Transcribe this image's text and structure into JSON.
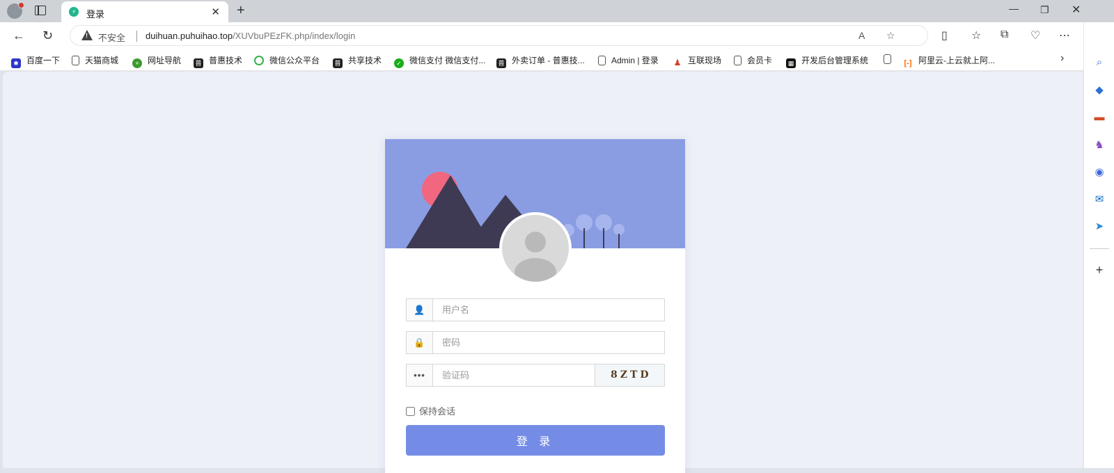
{
  "tab": {
    "title": "登录"
  },
  "address": {
    "insecure_label": "不安全",
    "host": "duihuan.puhuihao.top",
    "path": "/XUVbuPEzFK.php/index/login"
  },
  "bookmarks": [
    {
      "label": "百度一下",
      "icon": "paw-icon",
      "color": "#2b35c9"
    },
    {
      "label": "天猫商城",
      "icon": "page-icon",
      "color": "#555555"
    },
    {
      "label": "网址导航",
      "icon": "navigation-icon",
      "color": "#3c9a2e"
    },
    {
      "label": "普惠技术",
      "icon": "puhui-icon",
      "color": "#222222"
    },
    {
      "label": "微信公众平台",
      "icon": "wechat-mp-icon",
      "color": "#34b24a"
    },
    {
      "label": "共享技术",
      "icon": "puhui-icon",
      "color": "#222222"
    },
    {
      "label": "微信支付 微信支付...",
      "icon": "wechat-pay-icon",
      "color": "#1aad19"
    },
    {
      "label": "外卖订单 - 普惠技...",
      "icon": "puhui-icon",
      "color": "#222222"
    },
    {
      "label": "Admin | 登录",
      "icon": "page-icon",
      "color": "#555555"
    },
    {
      "label": "互联现场",
      "icon": "figure-icon",
      "color": "#d0402c"
    },
    {
      "label": "会员卡",
      "icon": "page-icon",
      "color": "#555555"
    },
    {
      "label": "开发后台管理系统",
      "icon": "qr-icon",
      "color": "#111111"
    },
    {
      "label": "",
      "icon": "page-icon",
      "color": "#555555"
    },
    {
      "label": "阿里云-上云就上阿...",
      "icon": "aliyun-icon",
      "color": "#ff6a00"
    }
  ],
  "login": {
    "username_placeholder": "用户名",
    "password_placeholder": "密码",
    "captcha_placeholder": "验证码",
    "captcha_text": "8ZTD",
    "remember_label": "保持会话",
    "submit_label": "登 录"
  },
  "colors": {
    "banner": "#8a9de3",
    "button": "#758ce6",
    "page_bg": "#eef0f8"
  }
}
